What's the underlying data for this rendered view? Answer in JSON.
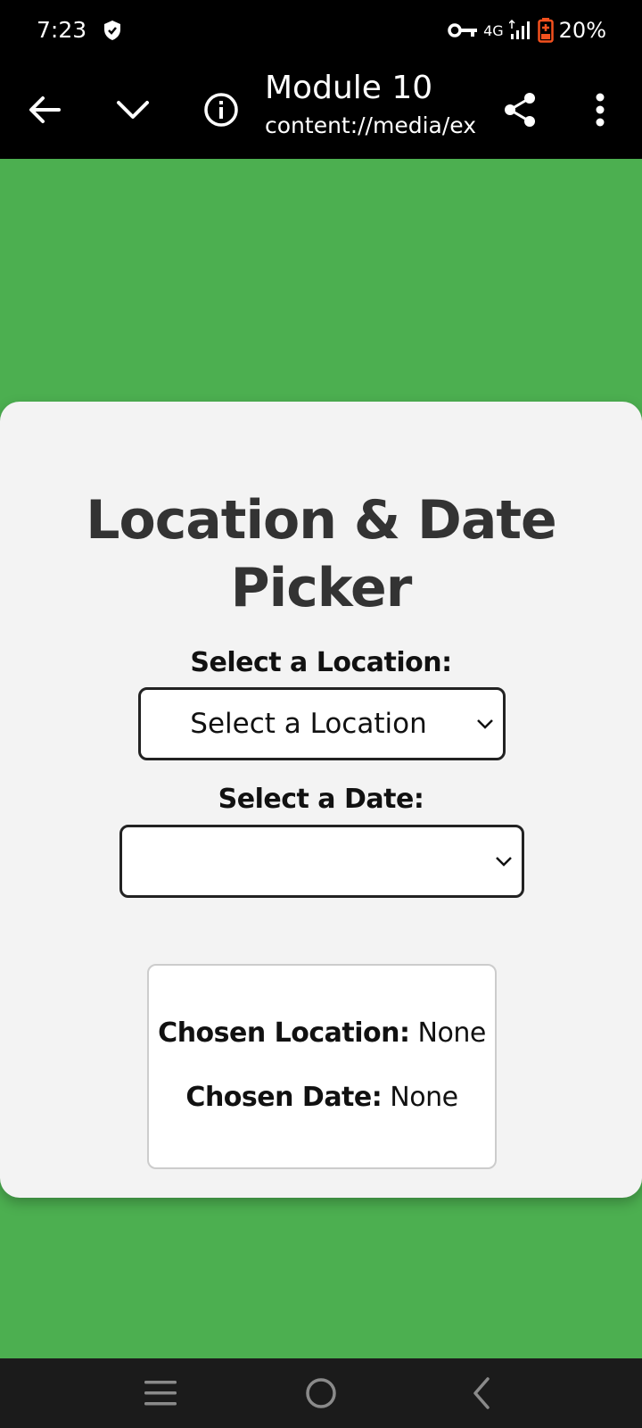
{
  "status_bar": {
    "time": "7:23",
    "network": "4G",
    "battery": "20%",
    "icons": [
      "shield-icon",
      "vpn-key-icon",
      "signal-icon",
      "battery-charging-icon"
    ]
  },
  "app_bar": {
    "title": "Module 10",
    "subtitle": "content://media/external",
    "icons": [
      "back-arrow-icon",
      "chevron-down-icon",
      "info-icon",
      "share-icon",
      "more-vert-icon"
    ]
  },
  "card": {
    "title": "Location & Date Picker",
    "location_label": "Select a Location:",
    "location_selected": "Select a Location",
    "date_label": "Select a Date:",
    "date_selected": "",
    "result": {
      "location_key": "Chosen Location:",
      "location_value": " None",
      "date_key": "Chosen Date:",
      "date_value": " None"
    }
  },
  "nav_bar": {
    "icons": [
      "recent-apps-icon",
      "home-icon",
      "back-icon"
    ]
  },
  "colors": {
    "page_background": "#4caf50",
    "card_background": "#f3f3f3",
    "title_color": "#333333",
    "bars": "#000000"
  }
}
